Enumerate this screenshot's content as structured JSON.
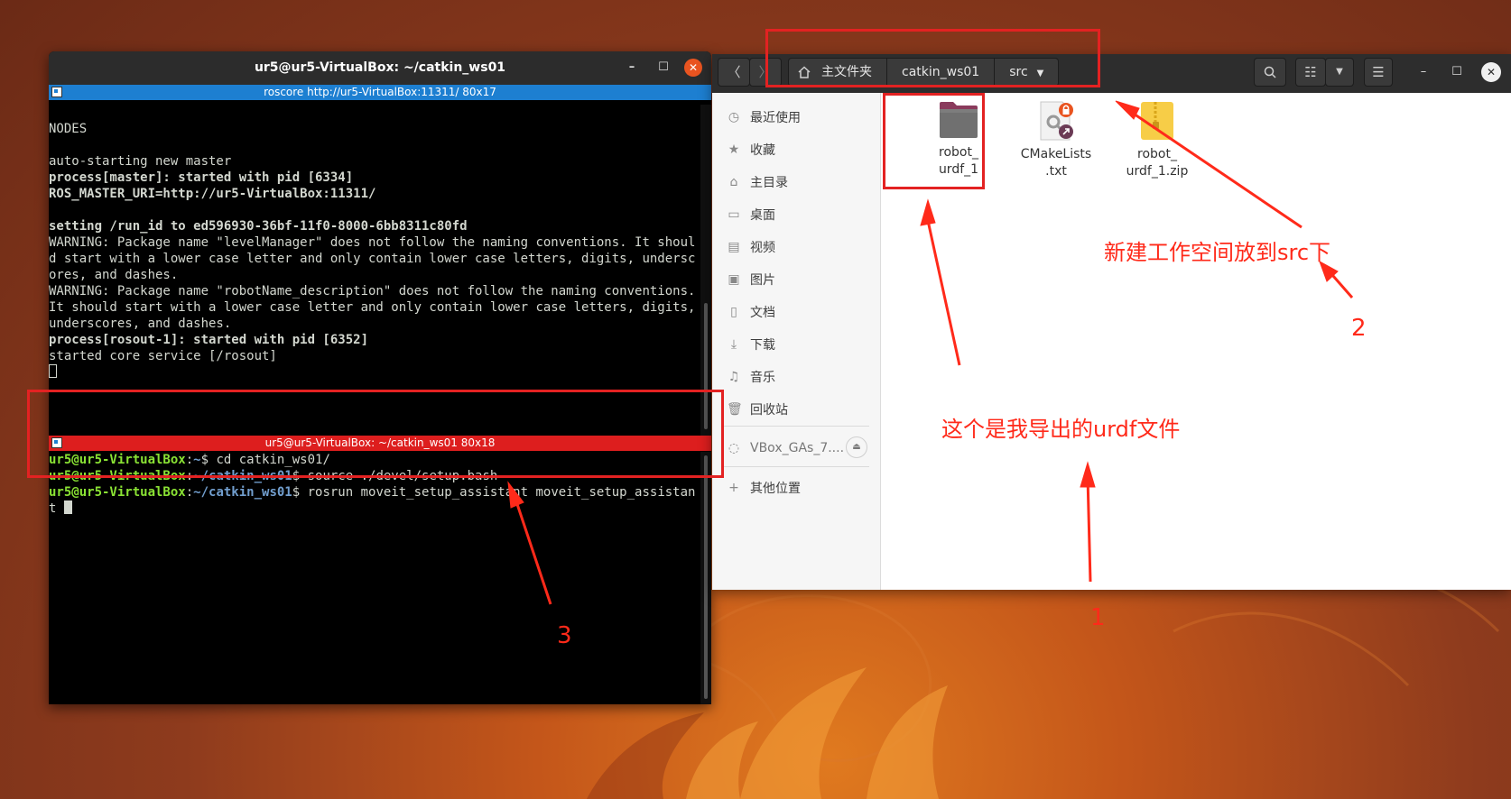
{
  "terminal": {
    "window_title": "ur5@ur5-VirtualBox: ~/catkin_ws01",
    "top_tab_title": "roscore http://ur5-VirtualBox:11311/ 80x17",
    "bottom_tab_title": "ur5@ur5-VirtualBox: ~/catkin_ws01 80x18",
    "roscore_lines": {
      "nodes": "NODES",
      "auto": "auto-starting new master",
      "master": "process[master]: started with pid [6334]",
      "uri": "ROS_MASTER_URI=http://ur5-VirtualBox:11311/",
      "runid": "setting /run_id to ed596930-36bf-11f0-8000-6bb8311c80fd",
      "warn1": "WARNING: Package name \"levelManager\" does not follow the naming conventions. It should start with a lower case letter and only contain lower case letters, digits, underscores, and dashes.",
      "warn2": "WARNING: Package name \"robotName_description\" does not follow the naming conventions. It should start with a lower case letter and only contain lower case letters, digits, underscores, and dashes.",
      "rosout": "process[rosout-1]: started with pid [6352]",
      "core": "started core service [/rosout]"
    },
    "prompt_user": "ur5@ur5-VirtualBox",
    "colon": ":",
    "home_path": "~",
    "ws_path": "~/catkin_ws01",
    "dollar": "$ ",
    "cmd1": "cd catkin_ws01/",
    "cmd2": "source ./devel/setup.bash",
    "cmd3": "rosrun moveit_setup_assistant moveit_setup_assistant "
  },
  "file_manager": {
    "breadcrumbs": [
      "主文件夹",
      "catkin_ws01",
      "src"
    ],
    "sidebar": [
      {
        "label": "最近使用",
        "icon": "clock-icon"
      },
      {
        "label": "收藏",
        "icon": "star-icon"
      },
      {
        "label": "主目录",
        "icon": "home-icon"
      },
      {
        "label": "桌面",
        "icon": "desktop-icon"
      },
      {
        "label": "视频",
        "icon": "video-icon"
      },
      {
        "label": "图片",
        "icon": "picture-icon"
      },
      {
        "label": "文档",
        "icon": "document-icon"
      },
      {
        "label": "下载",
        "icon": "download-icon"
      },
      {
        "label": "音乐",
        "icon": "music-icon"
      },
      {
        "label": "回收站",
        "icon": "trash-icon"
      },
      {
        "label": "VBox_GAs_7....",
        "icon": "drive-icon"
      },
      {
        "label": "其他位置",
        "icon": "plus-icon"
      }
    ],
    "files": [
      {
        "line1": "robot_",
        "line2": "urdf_1",
        "type": "folder"
      },
      {
        "line1": "CMakeLists",
        "line2": ".txt",
        "type": "locked-link-file"
      },
      {
        "line1": "robot_",
        "line2": "urdf_1.zip",
        "type": "zip-archive"
      }
    ]
  },
  "annotations": {
    "note_src": "新建工作空间放到src下",
    "note_urdf": "这个是我导出的urdf文件",
    "num1": "1",
    "num2": "2",
    "num3": "3",
    "color": "#ff2a1a"
  }
}
